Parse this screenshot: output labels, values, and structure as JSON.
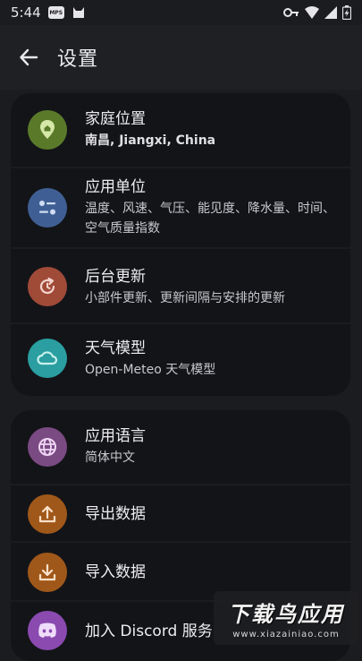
{
  "status_bar": {
    "time": "5:44",
    "chip_label": "MPS",
    "icons": [
      "mps-badge-icon",
      "cat-icon",
      "key-icon",
      "wifi-icon",
      "signal-icon",
      "battery-charging-icon"
    ]
  },
  "app_bar": {
    "title": "设置",
    "back_icon": "arrow-left-icon"
  },
  "settings_group_1": [
    {
      "title": "家庭位置",
      "subtitle": "南昌, Jiangxi, China",
      "icon": "location-pin-icon",
      "color": "#5a7a2a"
    },
    {
      "title": "应用单位",
      "subtitle": "温度、风速、气压、能见度、降水量、时间、空气质量指数",
      "icon": "sliders-icon",
      "color": "#3f5f94"
    },
    {
      "title": "后台更新",
      "subtitle": "小部件更新、更新间隔与安排的更新",
      "icon": "refresh-clock-icon",
      "color": "#a04a38"
    },
    {
      "title": "天气模型",
      "subtitle": "Open-Meteo 天气模型",
      "icon": "cloud-icon",
      "color": "#2a9ea0"
    }
  ],
  "settings_group_2": [
    {
      "title": "应用语言",
      "subtitle": "简体中文",
      "icon": "globe-icon",
      "color": "#7a4a82"
    },
    {
      "title": "导出数据",
      "subtitle": "",
      "icon": "upload-icon",
      "color": "#a0581a"
    },
    {
      "title": "导入数据",
      "subtitle": "",
      "icon": "download-icon",
      "color": "#a0581a"
    },
    {
      "title": "加入 Discord 服务",
      "subtitle": "",
      "icon": "discord-icon",
      "color": "#8a4ab0"
    }
  ],
  "watermark": {
    "main": "下载鸟应用",
    "sub": "www.xiazainiao.com"
  }
}
